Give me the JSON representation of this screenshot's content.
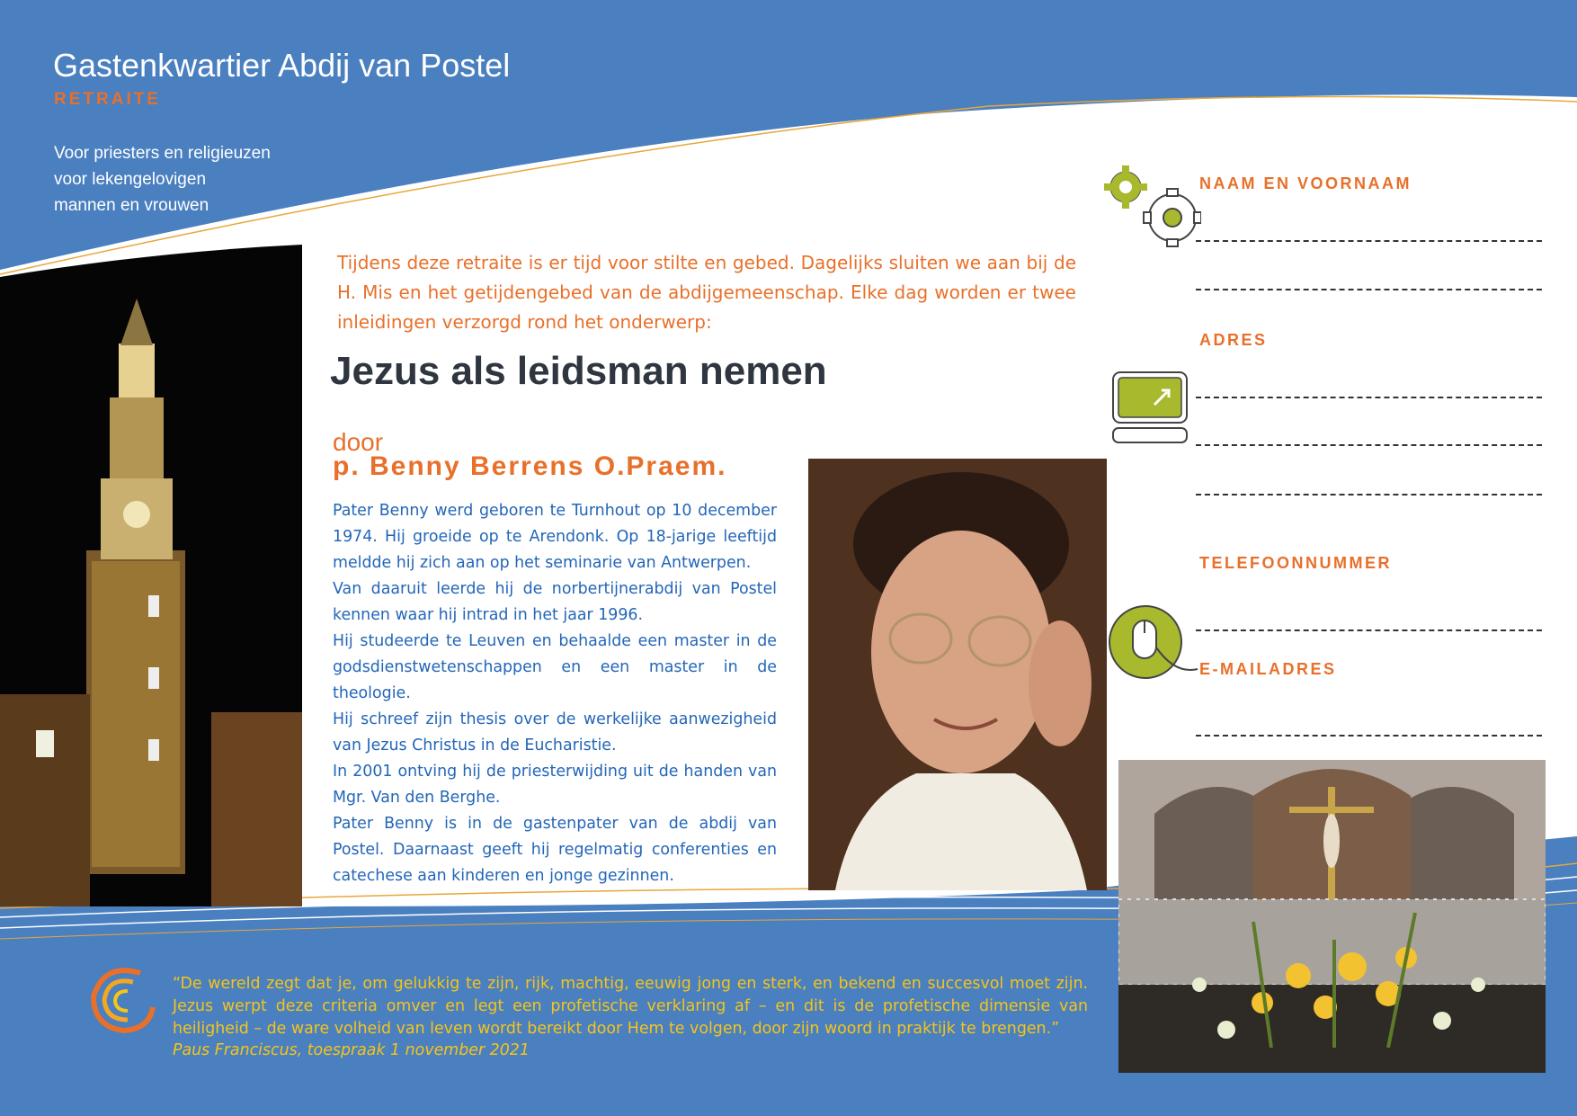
{
  "header": {
    "title": "Gastenkwartier Abdij van Postel",
    "subtitle": "RETRAITE",
    "audience": [
      "Voor priesters en religieuzen",
      "voor lekengelovigen",
      "mannen en vrouwen"
    ]
  },
  "main": {
    "intro": "Tijdens deze retraite is er tijd voor stilte en gebed. Dagelijks sluiten we aan bij de H. Mis en het getijdengebed van de abdijgemeenschap. Elke dag worden er twee inleidingen verzorgd rond het onderwerp:",
    "heading": "Jezus als leidsman nemen",
    "by_label": "door",
    "speaker": "p. Benny Berrens O.Praem.",
    "bio": [
      "Pater Benny werd geboren te Turnhout op 10 december 1974. Hij groeide op te Arendonk. Op 18-jarige leeftijd meldde hij zich aan op het seminarie van Antwerpen.",
      "Van daaruit leerde hij de norbertijnerabdij van Postel kennen waar hij intrad in het jaar 1996.",
      "Hij studeerde te Leuven en behaalde een master in de godsdienstwetenschappen en een master in de theologie.",
      "Hij schreef zijn thesis over de werkelijke aanwezigheid van Jezus Christus in de Eucharistie.",
      "In 2001 ontving hij de priesterwijding uit de handen van Mgr. Van den Berghe.",
      "Pater Benny is in de gastenpater van de abdij van Postel. Daarnaast geeft hij regelmatig conferenties en catechese aan kinderen en jonge gezinnen."
    ]
  },
  "form": {
    "name_label": "NAAM EN VOORNAAM",
    "address_label": "ADRES",
    "phone_label": "TELEFOONNUMMER",
    "email_label": "E-MAILADRES"
  },
  "quote": {
    "text": "“De wereld zegt dat je, om gelukkig te zijn, rijk, machtig, eeuwig jong en sterk, en bekend en succesvol moet zijn. Jezus werpt deze criteria omver en legt een profetische verklaring af – en dit is de profetische dimensie van heiligheid – de ware volheid van leven wordt bereikt door Hem te volgen, door zijn woord in praktijk te brengen.”",
    "source": "Paus Franciscus, toespraak 1 november 2021"
  },
  "icons": [
    "gears-icon",
    "computer-icon",
    "mouse-icon",
    "swirl-logo-icon"
  ],
  "colors": {
    "background": "#4a7fc0",
    "accent": "#e8702a",
    "heading": "#2f3640",
    "body_text": "#2366b8",
    "quote": "#f5c518",
    "icon_green": "#a8b92e"
  }
}
